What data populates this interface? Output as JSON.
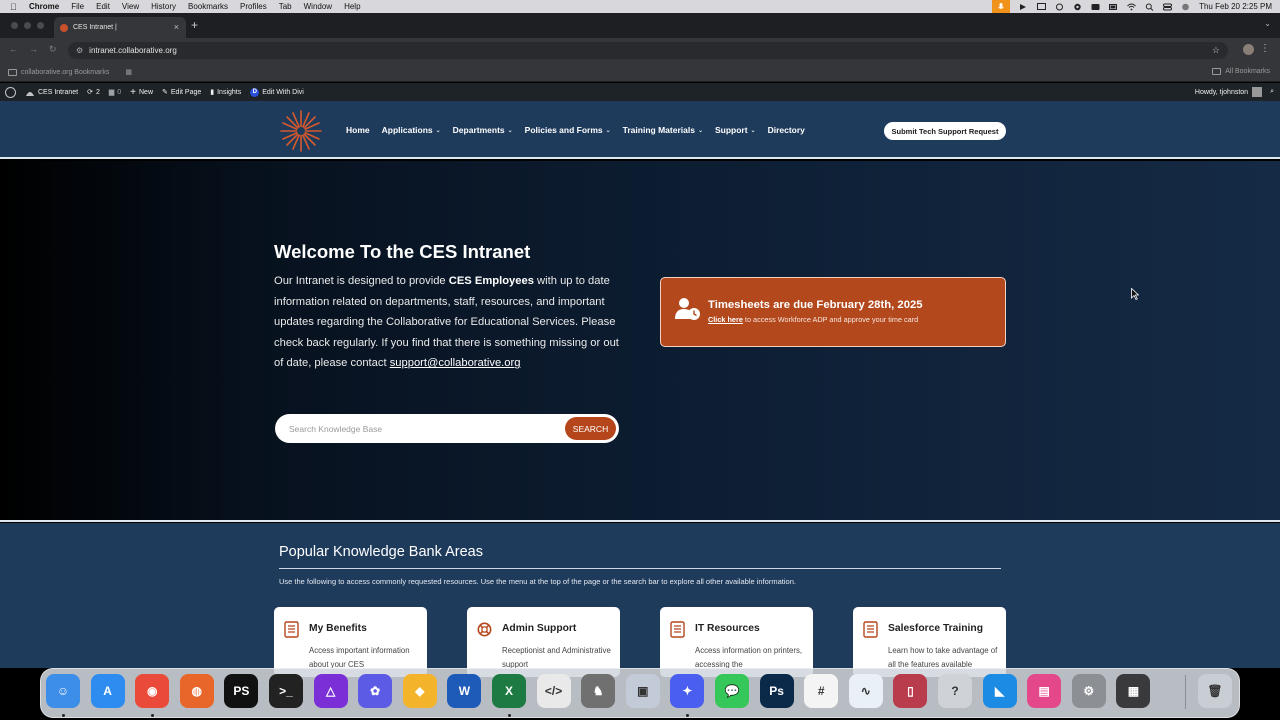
{
  "menubar": {
    "app": "Chrome",
    "items": [
      "File",
      "Edit",
      "View",
      "History",
      "Bookmarks",
      "Profiles",
      "Tab",
      "Window",
      "Help"
    ],
    "clock": "Thu Feb 20  2:25 PM"
  },
  "browser": {
    "tab_title": "CES Intranet |",
    "url": "intranet.collaborative.org",
    "bookmarks_left": "collaborative.org Bookmarks",
    "bookmarks_right": "All Bookmarks"
  },
  "wpbar": {
    "site": "CES Intranet",
    "updates": "2",
    "comments": "0",
    "new": "New",
    "edit_page": "Edit Page",
    "insights": "Insights",
    "edit_divi": "Edit With Divi",
    "howdy": "Howdy, tjohnston"
  },
  "nav": {
    "items": [
      {
        "label": "Home",
        "caret": ""
      },
      {
        "label": "Applications",
        "caret": "⌄"
      },
      {
        "label": "Departments",
        "caret": "⌄"
      },
      {
        "label": "Policies and Forms",
        "caret": "⌄"
      },
      {
        "label": "Training Materials",
        "caret": "⌄"
      },
      {
        "label": "Support",
        "caret": "⌄"
      },
      {
        "label": "Directory",
        "caret": ""
      }
    ],
    "cta": "Submit Tech Support Request"
  },
  "hero": {
    "title": "Welcome To the CES Intranet",
    "intro_1": "Our Intranet is designed to provide ",
    "intro_bold": "CES Employees",
    "intro_2": " with up to date information related on departments, staff, resources, and important updates regarding the Collaborative for Educational Services. Please check back regularly. If you find that there is something missing or out of date, please contact ",
    "email": "support@collaborative.org",
    "search_placeholder": "Search Knowledge Base",
    "search_button": "SEARCH"
  },
  "alert": {
    "title": "Timesheets are due February 28th, 2025",
    "link": "Click here",
    "text": " to access Workforce ADP and approve your time card"
  },
  "kb": {
    "title": "Popular Knowledge Bank Areas",
    "subtitle": "Use the following to access commonly requested resources. Use the menu at the top of the page or the search bar to explore all other available information.",
    "cards": [
      {
        "title": "My Benefits",
        "desc": "Access important information about your CES"
      },
      {
        "title": "Admin Support",
        "desc": "Receptionist and Administrative support"
      },
      {
        "title": "IT Resources",
        "desc": "Access information on printers, accessing the"
      },
      {
        "title": "Salesforce Training",
        "desc": "Learn how to take advantage of all the features available"
      }
    ]
  },
  "colors": {
    "accent": "#b5461b",
    "header": "#1f3b5c"
  },
  "dock": {
    "apps": [
      {
        "icon": "finder-icon",
        "glyph": "☺",
        "bg": "#3d8ee8"
      },
      {
        "icon": "app-store-icon",
        "glyph": "A",
        "bg": "#2e8cf0"
      },
      {
        "icon": "chrome-icon",
        "glyph": "◉",
        "bg": "#e94a3a"
      },
      {
        "icon": "firefox-icon",
        "glyph": "◍",
        "bg": "#e8662a"
      },
      {
        "icon": "phpstorm-icon",
        "glyph": "PS",
        "bg": "#111"
      },
      {
        "icon": "terminal-icon",
        "glyph": ">_",
        "bg": "#222"
      },
      {
        "icon": "affinity-icon",
        "glyph": "△",
        "bg": "#7b2fd6"
      },
      {
        "icon": "settings-flower-icon",
        "glyph": "✿",
        "bg": "#5b5be6"
      },
      {
        "icon": "sketch-icon",
        "glyph": "◆",
        "bg": "#f3b42b"
      },
      {
        "icon": "word-icon",
        "glyph": "W",
        "bg": "#1e5ab8"
      },
      {
        "icon": "excel-icon",
        "glyph": "X",
        "bg": "#1d7a43"
      },
      {
        "icon": "code-editor-icon",
        "glyph": "</>",
        "bg": "#e9e9ea"
      },
      {
        "icon": "tableplus-icon",
        "glyph": "♞",
        "bg": "#707070"
      },
      {
        "icon": "virtualbox-icon",
        "glyph": "▣",
        "bg": "#c4cbd8"
      },
      {
        "icon": "messenger-icon",
        "glyph": "✦",
        "bg": "#4a5ef0"
      },
      {
        "icon": "messages-icon",
        "glyph": "💬",
        "bg": "#35c759"
      },
      {
        "icon": "photoshop-icon",
        "glyph": "Ps",
        "bg": "#0b2a4a"
      },
      {
        "icon": "slack-icon",
        "glyph": "#",
        "bg": "#f4f4f4"
      },
      {
        "icon": "freeform-icon",
        "glyph": "∿",
        "bg": "#e9f0f7"
      },
      {
        "icon": "screen-sharing-icon",
        "glyph": "▯",
        "bg": "#b93c4c"
      },
      {
        "icon": "help-icon",
        "glyph": "?",
        "bg": "#cfd3d8"
      },
      {
        "icon": "app-icon",
        "glyph": "◣",
        "bg": "#1c8be3"
      },
      {
        "icon": "preview-icon",
        "glyph": "▤",
        "bg": "#e4488a"
      },
      {
        "icon": "system-settings-icon",
        "glyph": "⚙",
        "bg": "#8c8f94"
      },
      {
        "icon": "calculator-icon",
        "glyph": "▦",
        "bg": "#3a3a3c"
      },
      {
        "icon": "trash-icon",
        "glyph": "🗑",
        "bg": "#c9ced4"
      }
    ]
  }
}
